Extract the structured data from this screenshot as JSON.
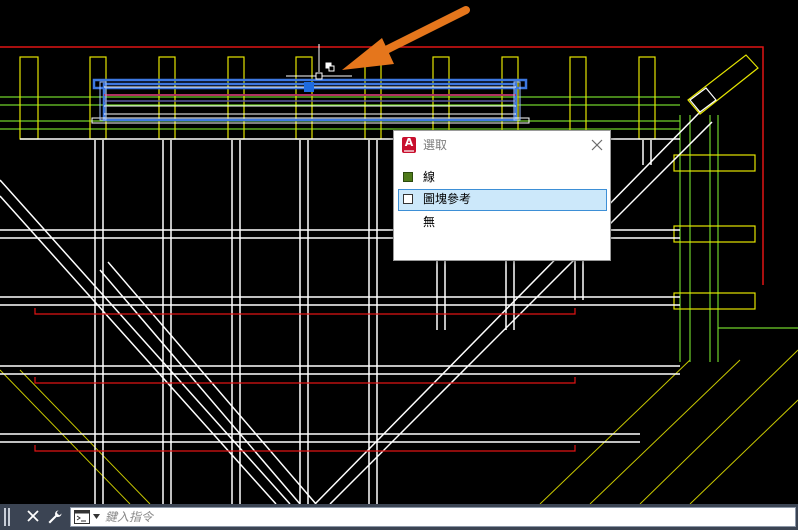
{
  "selection_popup": {
    "title": "選取",
    "options": [
      {
        "label": "線",
        "swatch": "#4f7a1a",
        "swatch_border": "#2b4a0e",
        "selected": false
      },
      {
        "label": "圖塊參考",
        "swatch": "#ffffff",
        "swatch_border": "#333333",
        "selected": true
      },
      {
        "label": "無",
        "swatch": "",
        "swatch_border": "",
        "selected": false
      }
    ]
  },
  "command_line": {
    "placeholder": "鍵入指令"
  },
  "annotation_arrow_color": "#e5761c",
  "colors": {
    "background": "#000000",
    "white_lines": "#ffffff",
    "yellow_lines": "#e4e400",
    "green_lines": "#6fd12a",
    "red_lines": "#e01414",
    "selection_blue": "#3d78e0",
    "command_bar": "#3b4453"
  }
}
